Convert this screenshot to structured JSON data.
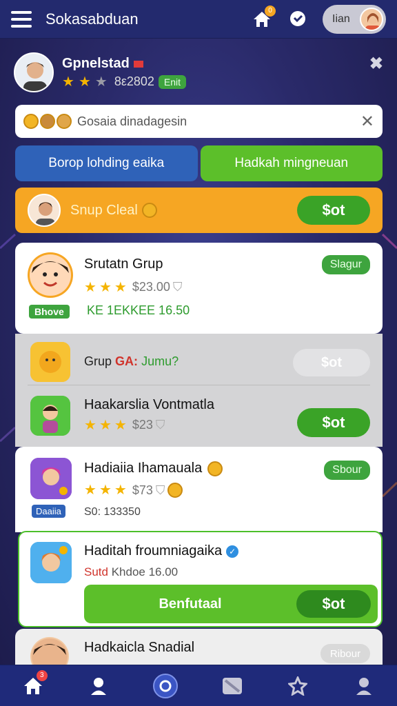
{
  "header": {
    "title": "Sokasabduan",
    "home_badge": "0",
    "profile_name": "Iian"
  },
  "user": {
    "name": "Gpnelstad",
    "score": "8ε2802",
    "tag": "Enit"
  },
  "search": {
    "value": "Gosaia dinadagesin"
  },
  "tabs": [
    {
      "label": "Borop lohding eaika"
    },
    {
      "label": "Hadkah mingneuan"
    }
  ],
  "promo": {
    "label": "Snup Cleal",
    "button": "$ot"
  },
  "items": [
    {
      "title": "Srutatn Grup",
      "price": "$23.00",
      "line": "KE 1EKKEE 16.50",
      "badge": "Bhove",
      "button": "Slagur"
    },
    {
      "title": "Grup",
      "title_red": "GA:",
      "title_green": "Jumu?",
      "button": "$ot"
    },
    {
      "title": "Haakarslia Vontmatla",
      "price": "$23",
      "button": "$ot"
    },
    {
      "title": "Hadiaiia Ihamauala",
      "price": "$73",
      "sub": "S0: 133350",
      "badge": "Daaiia",
      "button": "Sbour"
    },
    {
      "title": "Haditah froumniagaika",
      "red": "Sutd",
      "sub": "Khdoe 16.00",
      "wide_button": "Benfutaal",
      "button": "$ot"
    },
    {
      "title": "Hadkaicla Snadial",
      "button": "Ribour"
    }
  ],
  "colors": {
    "primary_green": "#3aa327",
    "orange": "#f6a623",
    "blue": "#2f62b8",
    "nav_bg": "#1f2a7a"
  },
  "nav": {
    "home_badge": "3"
  }
}
